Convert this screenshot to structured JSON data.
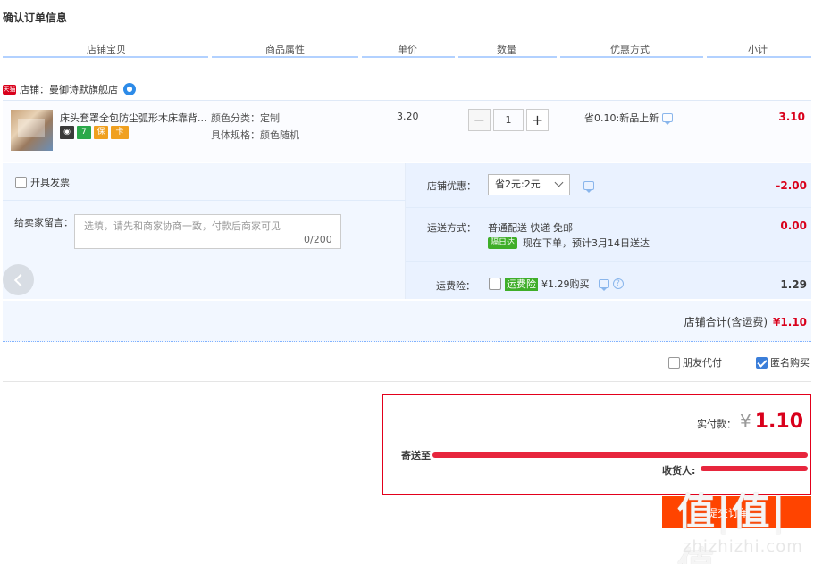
{
  "page_title": "确认订单信息",
  "columns": [
    "店铺宝贝",
    "商品属性",
    "单价",
    "数量",
    "优惠方式",
    "小计"
  ],
  "shop": {
    "tag": "天猫",
    "label": "店铺：曼御诗默旗舰店"
  },
  "item": {
    "name": "床头套罩全包防尘弧形木床靠背...",
    "badges": [
      "7",
      "保",
      "卡"
    ],
    "prop_color": "颜色分类：定制",
    "prop_spec": "具体规格：颜色随机",
    "unit_price": "3.20",
    "quantity": "1",
    "qty_minus": "−",
    "qty_plus": "+",
    "promo": "省0.10:新品上新",
    "subtotal": "3.10"
  },
  "invoice": {
    "label": "开具发票"
  },
  "message": {
    "label": "给卖家留言：",
    "placeholder": "选填，请先和商家协商一致，付款后商家可见",
    "count": "0/200"
  },
  "shop_discount": {
    "label": "店铺优惠：",
    "selected": "省2元:2元",
    "amount": "-2.00"
  },
  "shipping": {
    "label": "运送方式：",
    "method": "普通配送 快递 免邮",
    "tag": "隔日达",
    "note": "现在下单，预计3月14日送达",
    "amount": "0.00"
  },
  "freight_insurance": {
    "label": "运费险：",
    "tag": "运费险",
    "price": "¥1.29购买",
    "amount": "1.29"
  },
  "shop_total": {
    "label": "店铺合计(含运费)",
    "amount": "¥1.10"
  },
  "options": {
    "friend_pay": "朋友代付",
    "anonymous": "匿名购买"
  },
  "payment": {
    "label": "实付款：",
    "currency": "¥",
    "amount": "1.10",
    "ship_to": "寄送至",
    "receiver": "收货人:"
  },
  "submit_label": "提交订单",
  "watermark": {
    "logo": "值|值|值",
    "domain": "zhizhizhi.com"
  },
  "colors": {
    "accent_red": "#d9001b",
    "tmall_red": "#d9001b",
    "blue_line": "#b2d1ff",
    "panel_bg": "#f2f7ff",
    "submit_bg": "#ff4400",
    "checkbox_on": "#3b7ed9"
  }
}
